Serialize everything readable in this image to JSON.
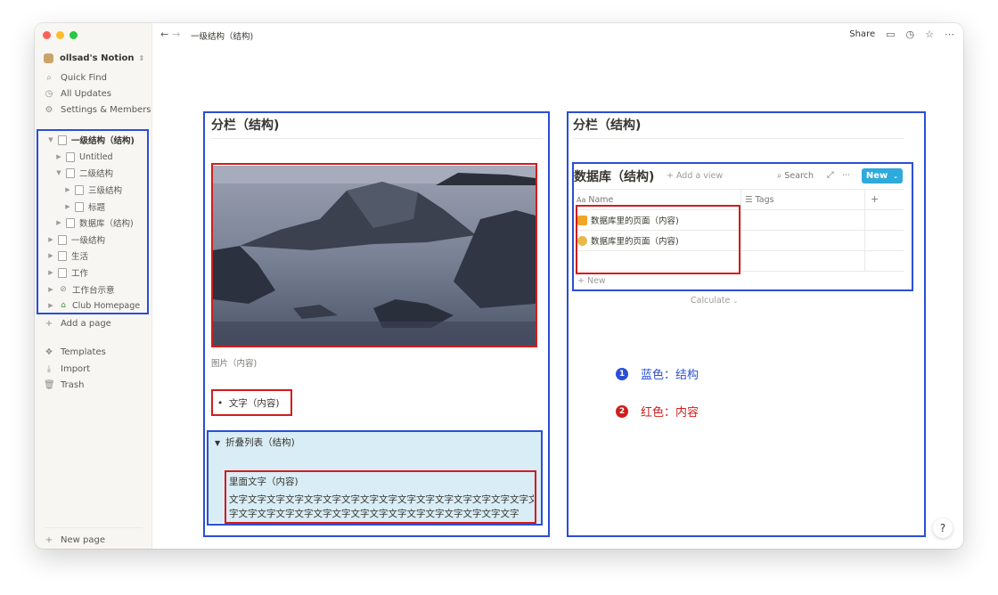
{
  "workspace": {
    "name": "ollsad's Notion",
    "switch_icon": "chevron-updown-icon"
  },
  "sidebar": {
    "top_items": [
      {
        "label": "Quick Find",
        "icon": "search-icon"
      },
      {
        "label": "All Updates",
        "icon": "clock-icon"
      },
      {
        "label": "Settings & Members",
        "icon": "gear-icon"
      }
    ],
    "tree": [
      {
        "label": "一级结构（结构)",
        "level": 0,
        "expanded": true
      },
      {
        "label": "Untitled",
        "level": 1,
        "expanded": false
      },
      {
        "label": "二级结构",
        "level": 1,
        "expanded": true
      },
      {
        "label": "三级结构",
        "level": 2,
        "expanded": false
      },
      {
        "label": "标题",
        "level": 2,
        "expanded": false
      },
      {
        "label": "数据库（结构)",
        "level": 1,
        "expanded": false
      },
      {
        "label": "一级结构",
        "level": 0,
        "expanded": false
      },
      {
        "label": "生活",
        "level": 0,
        "expanded": false
      },
      {
        "label": "工作",
        "level": 0,
        "expanded": false
      },
      {
        "label": "工作台示意",
        "level": 0,
        "expanded": false
      },
      {
        "label": "Club Homepage",
        "level": 0,
        "expanded": false
      }
    ],
    "add_page": "Add a page",
    "bottom_items": [
      {
        "label": "Templates",
        "icon": "templates-icon"
      },
      {
        "label": "Import",
        "icon": "import-icon"
      },
      {
        "label": "Trash",
        "icon": "trash-icon"
      }
    ],
    "new_page": "New page"
  },
  "topbar": {
    "breadcrumb": "一级结构（结构)",
    "share": "Share"
  },
  "left_column": {
    "title": "分栏（结构)",
    "image_caption": "图片（内容)",
    "bullet": "文字（内容)",
    "toggle_title": "折叠列表（结构)",
    "inner_title": "里面文字（内容)",
    "inner_line1": "文字文字文字文字文字文字文字文字文字文字文字文字文字文字文字文字文",
    "inner_line2": "字文字文字文字文字文字文字文字文字文字文字文字文字文字文字文字"
  },
  "right_column": {
    "title": "分栏（结构)",
    "db_title": "数据库（结构)",
    "add_view": "+ Add a view",
    "search": "Search",
    "new_button": "New",
    "col_name": "Name",
    "col_tags": "Tags",
    "rows": [
      {
        "name": "数据库里的页面（内容)",
        "emoji_color": "#f2a428"
      },
      {
        "name": "数据库里的页面（内容)",
        "emoji_color": "#e8b84a"
      }
    ],
    "new_row": "+ New",
    "calculate": "Calculate"
  },
  "legend": [
    {
      "num": "1",
      "text": "蓝色：结构",
      "color": "#2b4ed6"
    },
    {
      "num": "2",
      "text": "红色：内容",
      "color": "#d11d1d"
    }
  ],
  "help": "?",
  "colors": {
    "structure": "#2b4ed6",
    "content": "#d11d1d",
    "toggle_bg": "#d8edf6",
    "new_button": "#2eaadc"
  }
}
